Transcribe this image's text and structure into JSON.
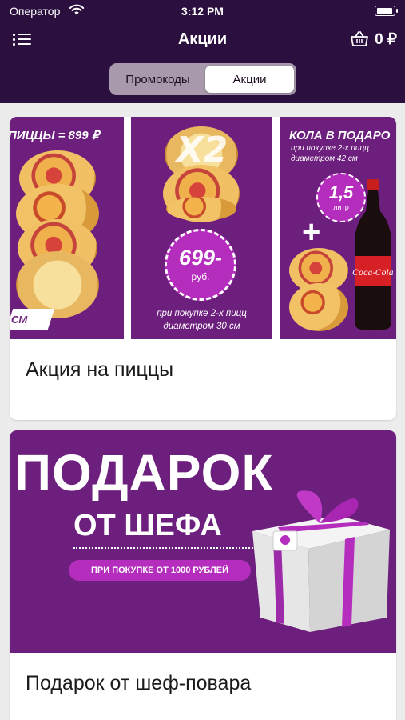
{
  "status_bar": {
    "carrier": "Оператор",
    "time": "3:12 PM"
  },
  "nav": {
    "title": "Акции",
    "cart_total": "0 ₽"
  },
  "segments": {
    "promo_codes": "Промокоды",
    "promotions": "Акции",
    "selected": "promotions"
  },
  "promotions": [
    {
      "title": "Акция на пиццы",
      "banner": {
        "panel1_text": "ПИЦЦЫ = 899 ₽",
        "panel1_tag": "СМ",
        "panel2_price": "699-",
        "panel2_unit": "руб.",
        "panel2_note_line1": "при покупке 2-х пицц",
        "panel2_note_line2": "диаметром 30 см",
        "panel3_title": "КОЛА В ПОДАРО",
        "panel3_note_line1": "при покупке 2-х пицц",
        "panel3_note_line2": "диаметром 42 см",
        "panel3_volume": "1,5",
        "panel3_volume_unit": "литр",
        "panel3_plus": "+",
        "panel3_bottle_label": "Coca-Cola"
      }
    },
    {
      "title": "Подарок от шеф-повара",
      "banner": {
        "headline": "ПОДАРОК",
        "subheadline": "ОТ ШЕФА",
        "condition": "ПРИ ПОКУПКЕ ОТ 1000 РУБЛЕЙ"
      }
    }
  ],
  "colors": {
    "header_bg": "#2b0f3f",
    "banner_purple": "#6d1f7d",
    "accent_magenta": "#b42dbc",
    "page_bg": "#ececec"
  }
}
